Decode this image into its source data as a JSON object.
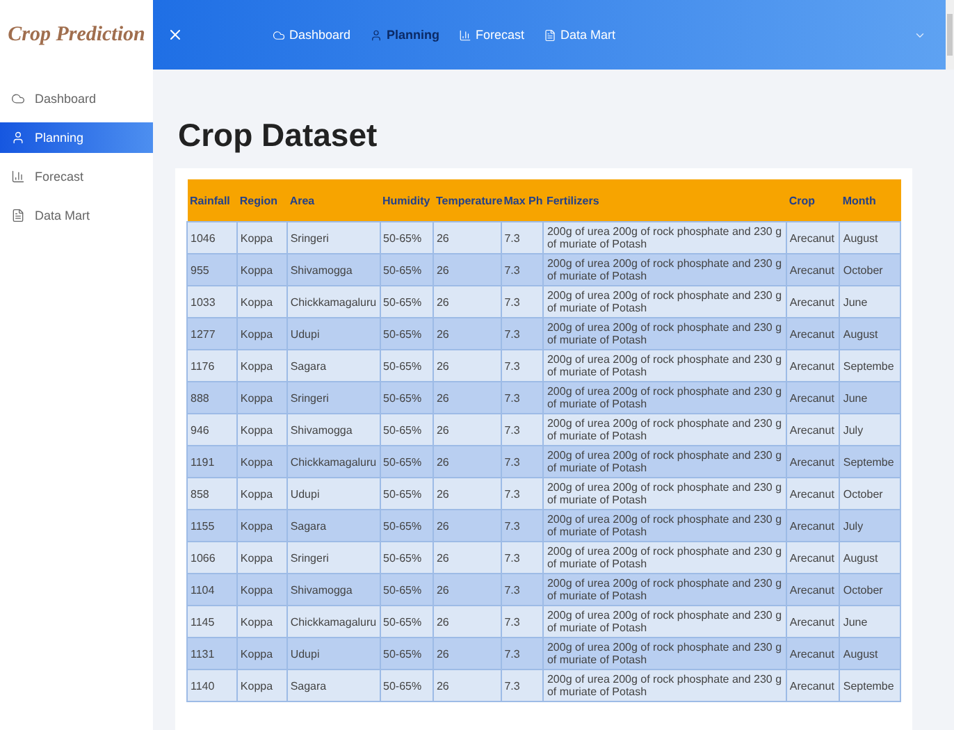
{
  "brand": "Crop Prediction",
  "topnav": [
    {
      "label": "Dashboard",
      "selected": false
    },
    {
      "label": "Planning",
      "selected": true
    },
    {
      "label": "Forecast",
      "selected": false
    },
    {
      "label": "Data Mart",
      "selected": false
    }
  ],
  "sidebar": {
    "items": [
      {
        "label": "Dashboard",
        "selected": false
      },
      {
        "label": "Planning",
        "selected": true
      },
      {
        "label": "Forecast",
        "selected": false
      },
      {
        "label": "Data Mart",
        "selected": false
      }
    ]
  },
  "page_title": "Crop Dataset",
  "table": {
    "columns": [
      "Rainfall",
      "Region",
      "Area",
      "Humidity",
      "Temperature",
      "Max Ph",
      "Fertilizers",
      "Crop",
      "Month"
    ],
    "rows": [
      [
        "1046",
        "Koppa",
        "Sringeri",
        "50-65%",
        "26",
        "7.3",
        "200g of urea 200g of rock phosphate and 230 g of muriate of Potash",
        "Arecanut",
        "August"
      ],
      [
        "955",
        "Koppa",
        "Shivamogga",
        "50-65%",
        "26",
        "7.3",
        "200g of urea 200g of rock phosphate and 230 g of muriate of Potash",
        "Arecanut",
        "October"
      ],
      [
        "1033",
        "Koppa",
        "Chickkamagaluru",
        "50-65%",
        "26",
        "7.3",
        "200g of urea 200g of rock phosphate and 230 g of muriate of Potash",
        "Arecanut",
        "June"
      ],
      [
        "1277",
        "Koppa",
        "Udupi",
        "50-65%",
        "26",
        "7.3",
        "200g of urea 200g of rock phosphate and 230 g of muriate of Potash",
        "Arecanut",
        "August"
      ],
      [
        "1176",
        "Koppa",
        "Sagara",
        "50-65%",
        "26",
        "7.3",
        "200g of urea 200g of rock phosphate and 230 g of muriate of Potash",
        "Arecanut",
        "Septembe"
      ],
      [
        "888",
        "Koppa",
        "Sringeri",
        "50-65%",
        "26",
        "7.3",
        "200g of urea 200g of rock phosphate and 230 g of muriate of Potash",
        "Arecanut",
        "June"
      ],
      [
        "946",
        "Koppa",
        "Shivamogga",
        "50-65%",
        "26",
        "7.3",
        "200g of urea 200g of rock phosphate and 230 g of muriate of Potash",
        "Arecanut",
        "July"
      ],
      [
        "1191",
        "Koppa",
        "Chickkamagaluru",
        "50-65%",
        "26",
        "7.3",
        "200g of urea 200g of rock phosphate and 230 g of muriate of Potash",
        "Arecanut",
        "Septembe"
      ],
      [
        "858",
        "Koppa",
        "Udupi",
        "50-65%",
        "26",
        "7.3",
        "200g of urea 200g of rock phosphate and 230 g of muriate of Potash",
        "Arecanut",
        "October"
      ],
      [
        "1155",
        "Koppa",
        "Sagara",
        "50-65%",
        "26",
        "7.3",
        "200g of urea 200g of rock phosphate and 230 g of muriate of Potash",
        "Arecanut",
        "July"
      ],
      [
        "1066",
        "Koppa",
        "Sringeri",
        "50-65%",
        "26",
        "7.3",
        "200g of urea 200g of rock phosphate and 230 g of muriate of Potash",
        "Arecanut",
        "August"
      ],
      [
        "1104",
        "Koppa",
        "Shivamogga",
        "50-65%",
        "26",
        "7.3",
        "200g of urea 200g of rock phosphate and 230 g of muriate of Potash",
        "Arecanut",
        "October"
      ],
      [
        "1145",
        "Koppa",
        "Chickkamagaluru",
        "50-65%",
        "26",
        "7.3",
        "200g of urea 200g of rock phosphate and 230 g of muriate of Potash",
        "Arecanut",
        "June"
      ],
      [
        "1131",
        "Koppa",
        "Udupi",
        "50-65%",
        "26",
        "7.3",
        "200g of urea 200g of rock phosphate and 230 g of muriate of Potash",
        "Arecanut",
        "August"
      ],
      [
        "1140",
        "Koppa",
        "Sagara",
        "50-65%",
        "26",
        "7.3",
        "200g of urea 200g of rock phosphate and 230 g of muriate of Potash",
        "Arecanut",
        "Septembe"
      ]
    ]
  }
}
